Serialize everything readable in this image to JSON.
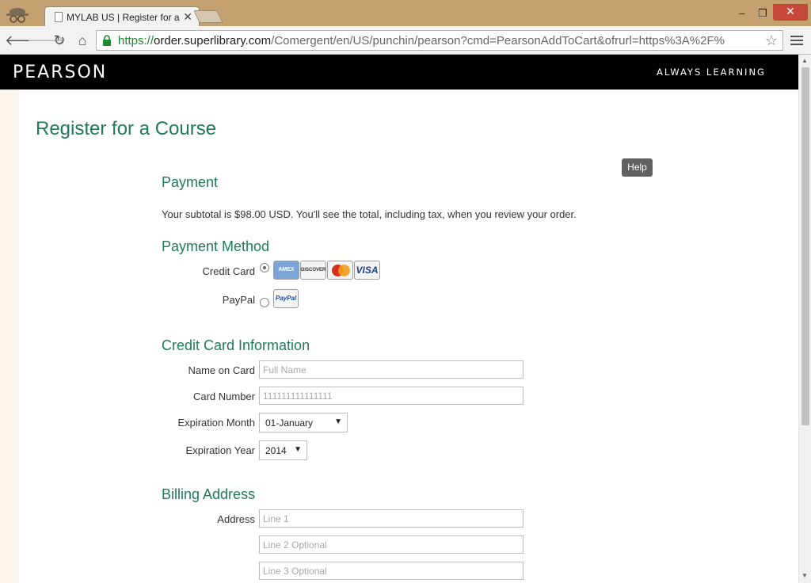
{
  "browser": {
    "tab_title": "MYLAB US | Register for a",
    "tab_close": "✕",
    "url_scheme": "https://",
    "url_host": "order.superlibrary.com",
    "url_rest": "/Comergent/en/US/punchin/pearson?cmd=PearsonAddToCart&ofrurl=https%3A%2F%",
    "window_controls": {
      "minimize": "–",
      "maximize": "❐",
      "close": "✕"
    },
    "nav": {
      "back": "🡐",
      "forward": "🡒",
      "reload": "↻",
      "home": "⌂",
      "bookmark": "☆"
    }
  },
  "header": {
    "logo": "PEARSON",
    "tagline": "ALWAYS LEARNING"
  },
  "page": {
    "title": "Register for a Course",
    "help_label": "Help"
  },
  "payment": {
    "heading": "Payment",
    "subtotal_text": "Your subtotal is $98.00 USD. You'll see the total, including tax, when you review your order."
  },
  "payment_method": {
    "heading": "Payment Method",
    "credit_card_label": "Credit Card",
    "credit_card_selected": true,
    "paypal_label": "PayPal",
    "paypal_selected": false,
    "card_logos": {
      "amex": "AMEX",
      "discover": "DISCOVER",
      "mastercard": "MasterCard",
      "visa": "VISA",
      "paypal": "PayPal"
    }
  },
  "credit_card_info": {
    "heading": "Credit Card Information",
    "name_label": "Name on Card",
    "name_placeholder": "Full Name",
    "number_label": "Card Number",
    "number_placeholder": "111111111111111",
    "month_label": "Expiration Month",
    "month_value": "01-January",
    "year_label": "Expiration Year",
    "year_value": "2014",
    "caret": "▼"
  },
  "billing": {
    "heading": "Billing Address",
    "address_label": "Address",
    "line1_placeholder": "Line 1",
    "line2_placeholder": "Line 2 Optional",
    "line3_placeholder": "Line 3 Optional"
  }
}
